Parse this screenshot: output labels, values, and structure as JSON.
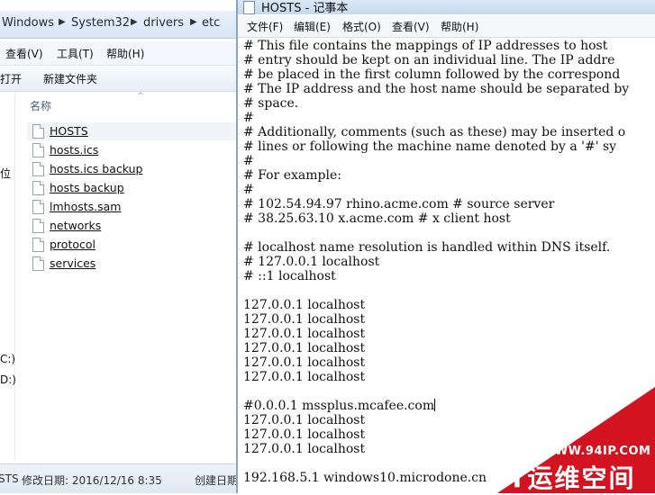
{
  "explorer": {
    "breadcrumb": [
      "Windows",
      "System32",
      "drivers",
      "etc"
    ],
    "menu": [
      "查看(V)",
      "工具(T)",
      "帮助(H)"
    ],
    "toolbar": [
      "打开",
      "新建文件夹"
    ],
    "nav_fragments": [
      "位",
      "C:)",
      "D:)"
    ],
    "column_header": "名称",
    "files": [
      "HOSTS",
      "hosts.ics",
      "hosts.ics backup",
      "hosts backup",
      "lmhosts.sam",
      "networks",
      "protocol",
      "services"
    ],
    "selected_file_index": 0,
    "status": {
      "name": "STS",
      "modified": "修改日期: 2016/12/16 8:35",
      "created": "创建日期"
    }
  },
  "notepad": {
    "title": "HOSTS - 记事本",
    "menu": [
      "文件(F)",
      "编辑(E)",
      "格式(O)",
      "查看(V)",
      "帮助(H)"
    ],
    "lines": [
      "# This file contains the mappings of IP addresses to host",
      "# entry should be kept on an individual line. The IP addre",
      "# be placed in the first column followed by the correspond",
      "# The IP address and the host name should be separated by",
      "# space.",
      "#",
      "# Additionally, comments (such as these) may be inserted o",
      "# lines or following the machine name denoted by a '#' sy",
      "#",
      "# For example:",
      "#",
      "# 102.54.94.97 rhino.acme.com # source server",
      "# 38.25.63.10 x.acme.com # x client host",
      "",
      "# localhost name resolution is handled within DNS itself.",
      "# 127.0.0.1 localhost",
      "# ::1 localhost",
      "",
      "127.0.0.1 localhost",
      "127.0.0.1 localhost",
      "127.0.0.1 localhost",
      "127.0.0.1 localhost",
      "127.0.0.1 localhost",
      "127.0.0.1 localhost",
      "",
      "#0.0.0.1 mssplus.mcafee.com",
      "127.0.0.1 localhost",
      "127.0.0.1 localhost",
      "127.0.0.1 localhost",
      "",
      "192.168.5.1 windows10.microdone.cn"
    ],
    "caret_line_index": 25
  },
  "watermark": {
    "url": "WWW.94IP.COM",
    "brand": "IT运维空间",
    "color": "#d3131f"
  }
}
